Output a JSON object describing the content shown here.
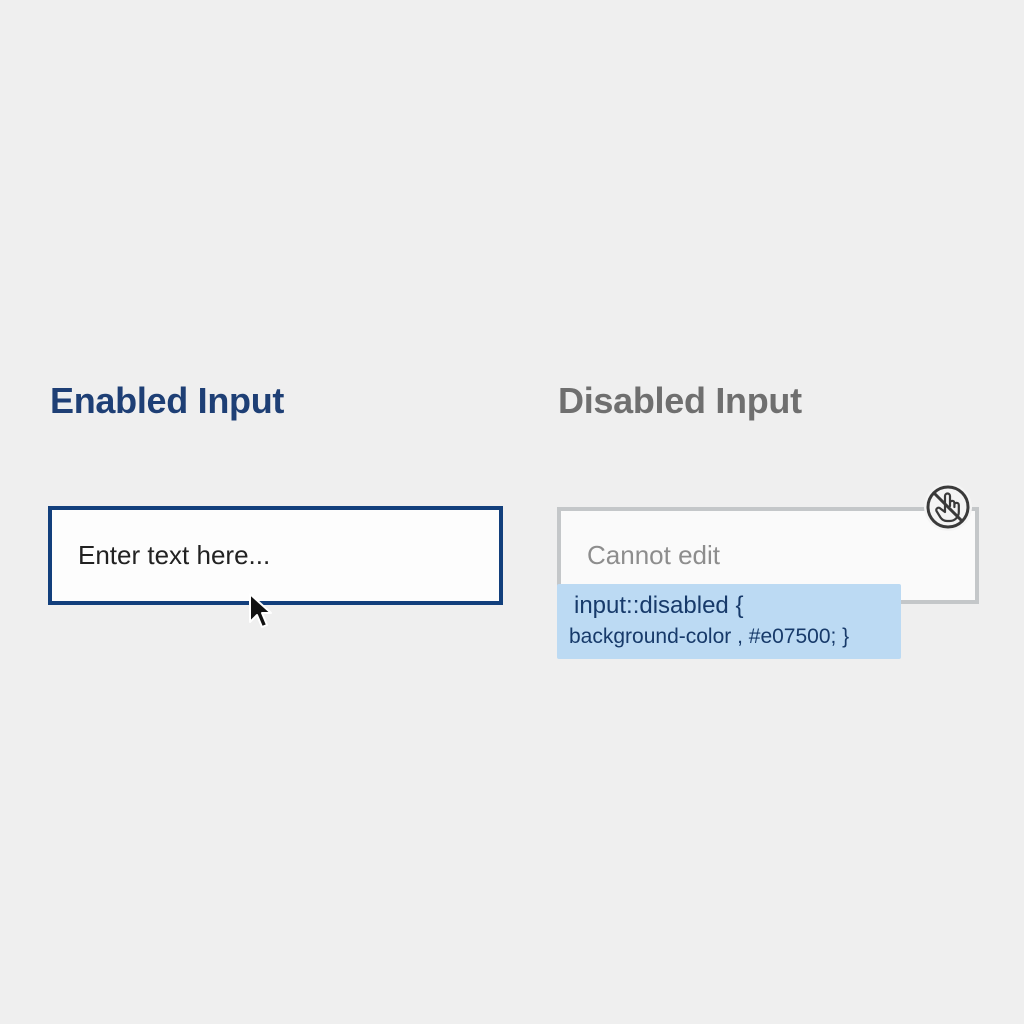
{
  "enabled_section": {
    "title": "Enabled Input",
    "input_placeholder": "Enter text here...",
    "border_color": "#123f7c",
    "title_color": "#1e3f75"
  },
  "disabled_section": {
    "title": "Disabled Input",
    "input_text": "Cannot edit",
    "border_color": "#c4c7c9",
    "title_color": "#6f6f6f",
    "status_icon": "no-touch-icon"
  },
  "tooltip": {
    "line1": "input::disabled {",
    "line2": "background-color , #e07500; }",
    "background": "#bcdaf3"
  },
  "cursor_icon": "mouse-pointer-icon",
  "background_color": "#efefef"
}
